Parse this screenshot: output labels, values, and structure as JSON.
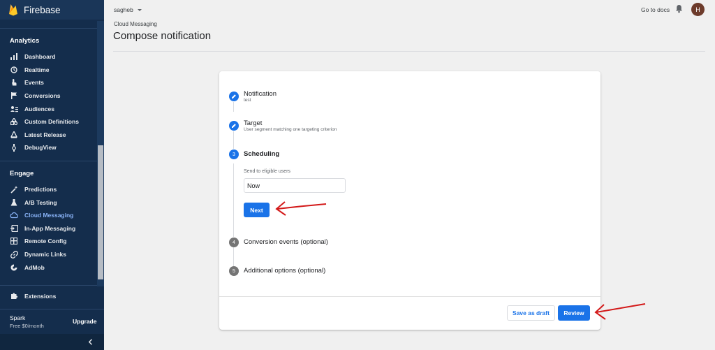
{
  "app": {
    "name": "Firebase"
  },
  "sidebar": {
    "sections": [
      {
        "title": "Analytics"
      },
      {
        "title": "Engage"
      }
    ],
    "analytics_items": [
      {
        "label": "Dashboard",
        "icon": "bar-chart-icon"
      },
      {
        "label": "Realtime",
        "icon": "clock-icon"
      },
      {
        "label": "Events",
        "icon": "touch-icon"
      },
      {
        "label": "Conversions",
        "icon": "flag-icon"
      },
      {
        "label": "Audiences",
        "icon": "audience-icon"
      },
      {
        "label": "Custom Definitions",
        "icon": "shapes-icon"
      },
      {
        "label": "Latest Release",
        "icon": "release-icon"
      },
      {
        "label": "DebugView",
        "icon": "debug-icon"
      }
    ],
    "engage_items": [
      {
        "label": "Predictions",
        "icon": "wand-icon"
      },
      {
        "label": "A/B Testing",
        "icon": "flask-icon"
      },
      {
        "label": "Cloud Messaging",
        "icon": "cloud-icon",
        "active": true
      },
      {
        "label": "In-App Messaging",
        "icon": "in-app-icon"
      },
      {
        "label": "Remote Config",
        "icon": "remote-config-icon"
      },
      {
        "label": "Dynamic Links",
        "icon": "link-icon"
      },
      {
        "label": "AdMob",
        "icon": "admob-icon"
      }
    ],
    "extensions": {
      "label": "Extensions",
      "icon": "puzzle-icon"
    },
    "plan": {
      "name": "Spark",
      "price": "Free $0/month"
    },
    "upgrade_label": "Upgrade"
  },
  "header": {
    "project": "sagheb",
    "breadcrumb": "Cloud Messaging",
    "title": "Compose notification",
    "docs_link": "Go to docs",
    "avatar_initial": "H"
  },
  "compose": {
    "steps": [
      {
        "label": "Notification",
        "sub": "test",
        "state": "done"
      },
      {
        "label": "Target",
        "sub": "User segment matching one targeting criterion",
        "state": "done"
      },
      {
        "label": "Scheduling",
        "number": "3",
        "state": "active"
      },
      {
        "label": "Conversion events (optional)",
        "number": "4",
        "state": "pending"
      },
      {
        "label": "Additional options (optional)",
        "number": "5",
        "state": "pending"
      }
    ],
    "scheduling": {
      "field_label": "Send to eligible users",
      "value": "Now",
      "next_label": "Next"
    },
    "save_draft_label": "Save as draft",
    "review_label": "Review"
  },
  "colors": {
    "sidebar_bg": "#142d4c",
    "accent": "#1a73e8",
    "annotation_arrow": "#d31919"
  }
}
